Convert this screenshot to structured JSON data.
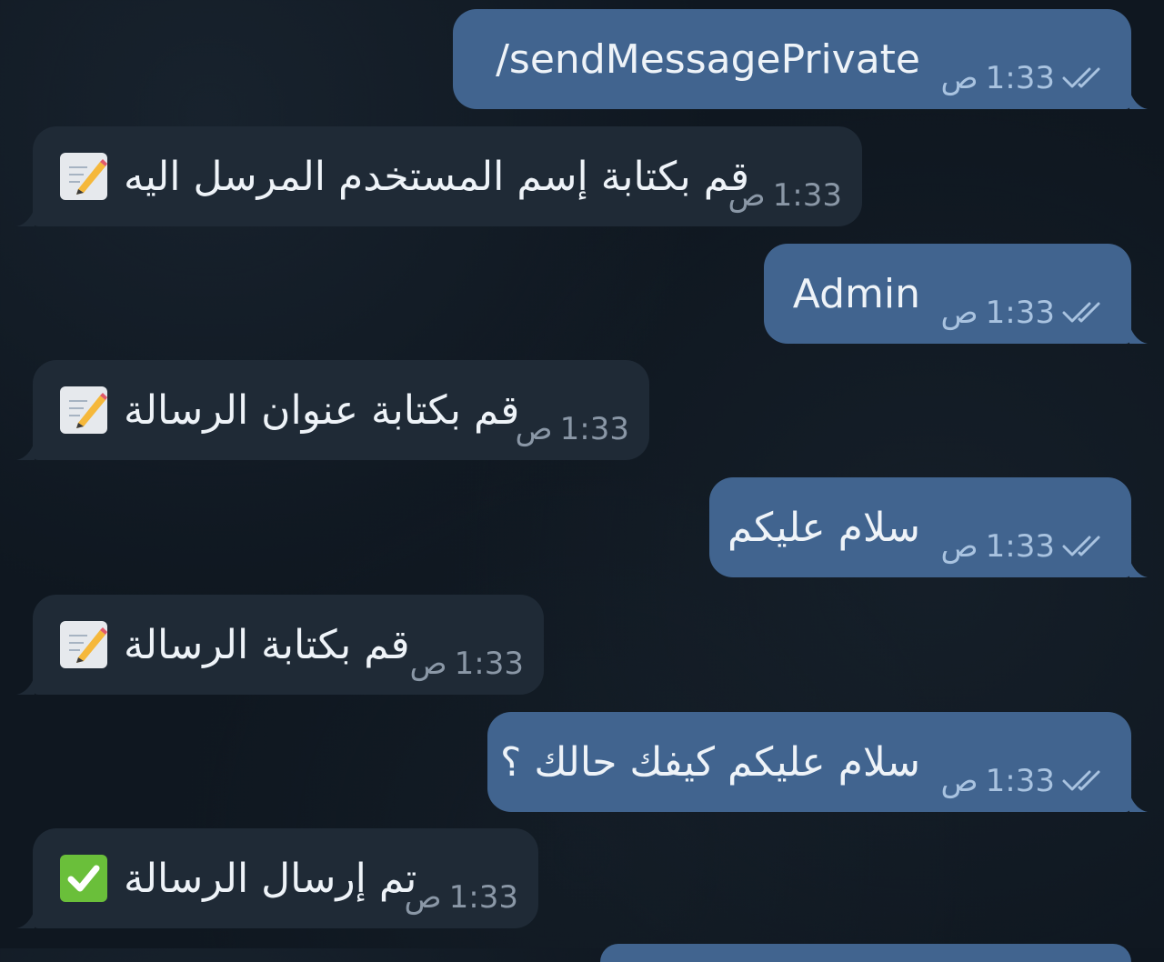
{
  "messages": [
    {
      "id": "m1",
      "direction": "out",
      "text": "/sendMessagePrivate",
      "time": "1:33",
      "period": "ص",
      "status_icon": "double-check-icon"
    },
    {
      "id": "m2",
      "direction": "in",
      "text": "قم بكتابة إسم المستخدم المرسل اليه",
      "emoji": "memo-icon",
      "time": "1:33",
      "period": "ص"
    },
    {
      "id": "m3",
      "direction": "out",
      "text": "Admin",
      "time": "1:33",
      "period": "ص",
      "status_icon": "double-check-icon"
    },
    {
      "id": "m4",
      "direction": "in",
      "text": "قم بكتابة عنوان الرسالة",
      "emoji": "memo-icon",
      "time": "1:33",
      "period": "ص"
    },
    {
      "id": "m5",
      "direction": "out",
      "text": "سلام عليكم",
      "time": "1:33",
      "period": "ص",
      "status_icon": "double-check-icon"
    },
    {
      "id": "m6",
      "direction": "in",
      "text": "قم بكتابة الرسالة",
      "emoji": "memo-icon",
      "time": "1:33",
      "period": "ص"
    },
    {
      "id": "m7",
      "direction": "out",
      "text": "سلام عليكم كيفك حالك ؟",
      "time": "1:33",
      "period": "ص",
      "status_icon": "double-check-icon"
    },
    {
      "id": "m8",
      "direction": "in",
      "text": "تم إرسال الرسالة",
      "emoji": "check-mark-icon",
      "time": "1:33",
      "period": "ص"
    }
  ],
  "colors": {
    "background": "#0f1720",
    "outgoing_bubble": "#41648f",
    "incoming_bubble": "#1f2a36",
    "outgoing_meta": "#a9c3e0",
    "incoming_meta": "#8a97a6",
    "check_green": "#6abf3a"
  }
}
